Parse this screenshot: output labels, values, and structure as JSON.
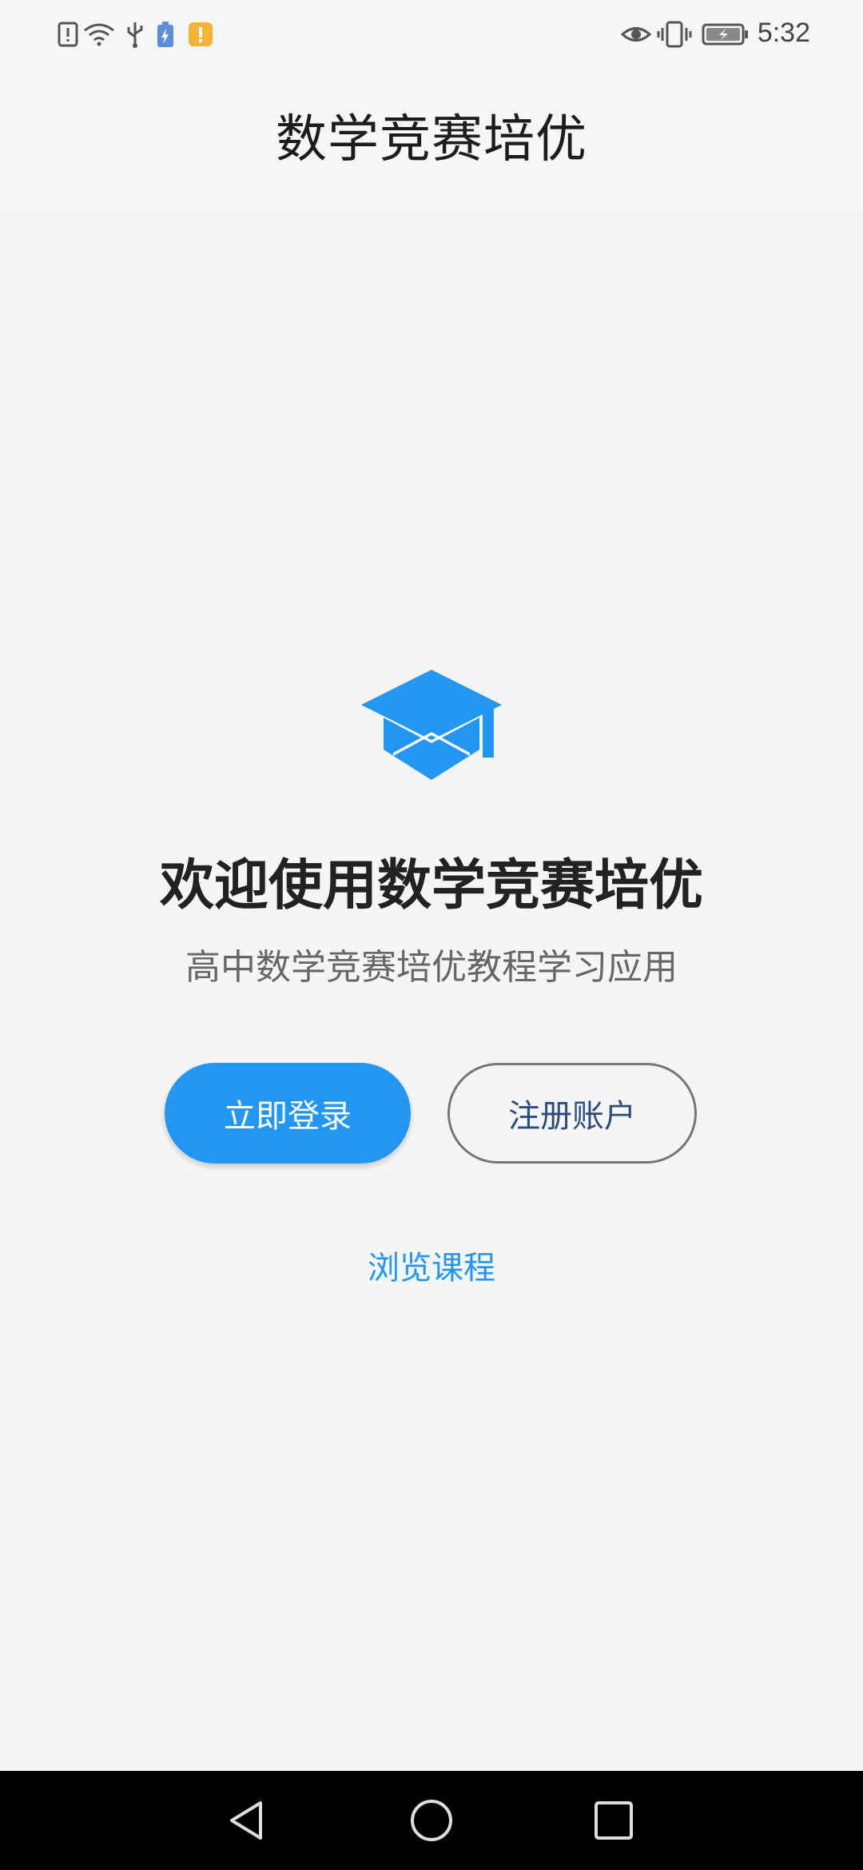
{
  "status_bar": {
    "time": "5:32",
    "icons": [
      "alert-icon",
      "wifi-icon",
      "usb-icon",
      "battery-saver-icon",
      "notification-icon",
      "eye-icon",
      "vibrate-icon",
      "battery-icon"
    ]
  },
  "app_bar": {
    "title": "数学竞赛培优"
  },
  "main": {
    "logo_icon": "graduation-cap-icon",
    "welcome": "欢迎使用数学竞赛培优",
    "subtitle": "高中数学竞赛培优教程学习应用",
    "login_button": "立即登录",
    "register_button": "注册账户",
    "browse_link": "浏览课程"
  },
  "nav_bar": {
    "back": "back-icon",
    "home": "home-icon",
    "recents": "recents-icon"
  },
  "colors": {
    "accent": "#2196F3",
    "background": "#F5F5F5",
    "register_text": "#2C4E7E"
  }
}
